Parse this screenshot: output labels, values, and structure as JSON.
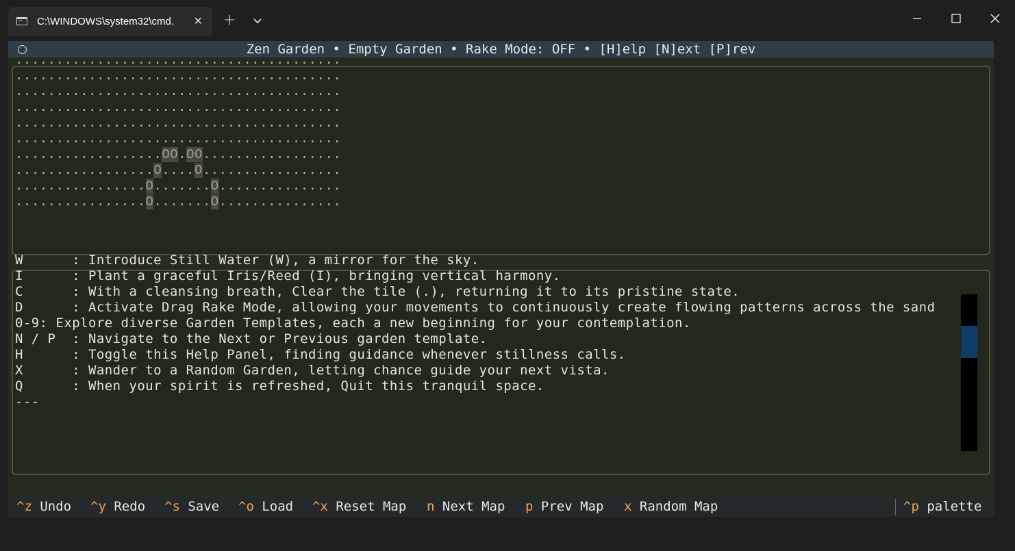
{
  "window": {
    "tab_title": "C:\\WINDOWS\\system32\\cmd.",
    "new_tab_symbol": "+",
    "close_tab_symbol": "✕"
  },
  "app": {
    "header_title": "Zen Garden • Empty Garden • Rake Mode: OFF • [H]elp [N]ext [P]rev"
  },
  "garden": {
    "rows": [
      "........................................",
      "........................................",
      "........................................",
      "........................................",
      "........................................",
      "........................................",
      "..................OO.OO.................",
      ".................O....O.................",
      "................O.......O...............",
      "................O.......O..............."
    ]
  },
  "help": {
    "lines": [
      "W      : Introduce Still Water (W), a mirror for the sky.",
      "I      : Plant a graceful Iris/Reed (I), bringing vertical harmony.",
      "C      : With a cleansing breath, Clear the tile (.), returning it to its pristine state.",
      "D      : Activate Drag Rake Mode, allowing your movements to continuously create flowing patterns across the sand",
      "0-9: Explore diverse Garden Templates, each a new beginning for your contemplation.",
      "N / P  : Navigate to the Next or Previous garden template.",
      "H      : Toggle this Help Panel, finding guidance whenever stillness calls.",
      "X      : Wander to a Random Garden, letting chance guide your next vista.",
      "Q      : When your spirit is refreshed, Quit this tranquil space.",
      "---"
    ]
  },
  "footer": {
    "items": [
      {
        "key": "^z",
        "label": "Undo"
      },
      {
        "key": "^y",
        "label": "Redo"
      },
      {
        "key": "^s",
        "label": "Save"
      },
      {
        "key": "^o",
        "label": "Load"
      },
      {
        "key": "^x",
        "label": "Reset Map"
      },
      {
        "key": "n",
        "label": "Next Map"
      },
      {
        "key": "p",
        "label": "Prev Map"
      },
      {
        "key": "x",
        "label": "Random Map"
      }
    ],
    "palette": {
      "key": "^p",
      "label": "palette"
    }
  },
  "colors": {
    "key_accent": "#f0a54a",
    "header_bg": "#2f3d47",
    "panel_border": "#4f5138",
    "scroll_thumb": "#0f3b68"
  }
}
